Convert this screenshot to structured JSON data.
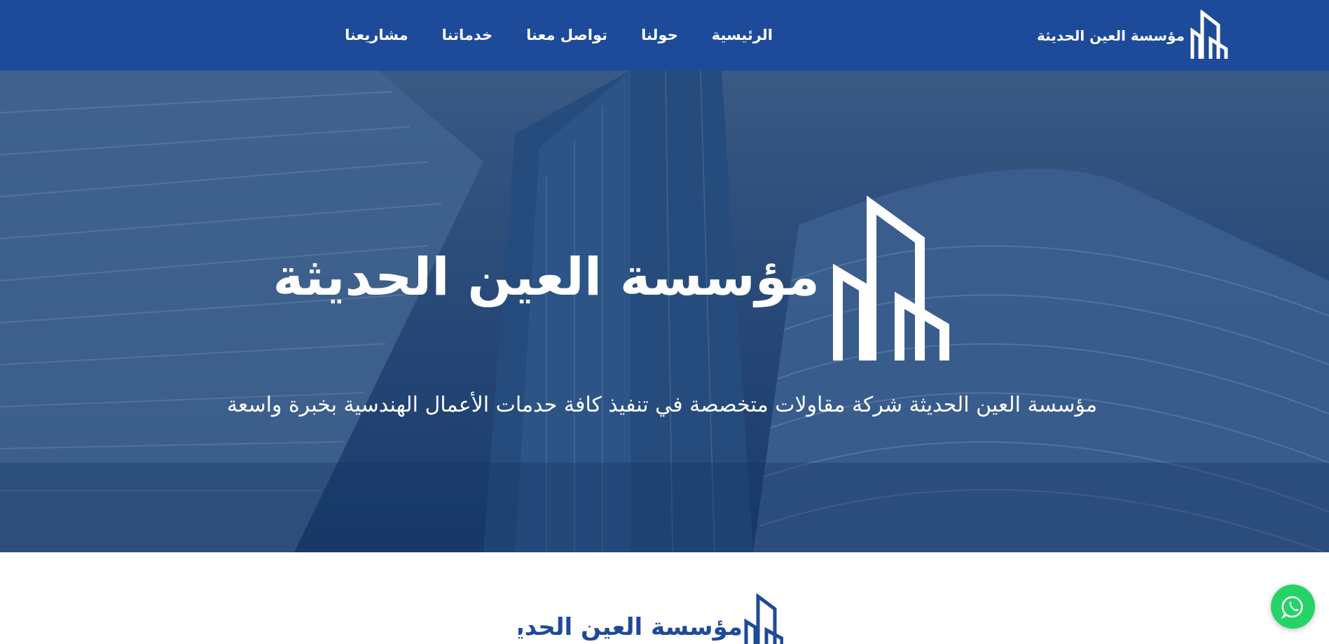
{
  "header": {
    "brand_name": "مؤسسة العين الحديثة",
    "logo_icon": "building-logo-icon",
    "nav": [
      {
        "label": "الرئيسية"
      },
      {
        "label": "حولنا"
      },
      {
        "label": "تواصل معنا"
      },
      {
        "label": "خدماتنا"
      },
      {
        "label": "مشاريعنا"
      }
    ]
  },
  "hero": {
    "title": "مؤسسة العين الحديثة",
    "subtitle": "مؤسسة العين الحديثة شركة مقاولات متخصصة في تنفيذ كافة حدمات الأعمال الهندسية بخبرة واسعة",
    "background": "skyscrapers-photo"
  },
  "section": {
    "brand_name": "مؤسسة العين الحديثة"
  },
  "whatsapp": {
    "icon": "whatsapp-icon"
  },
  "colors": {
    "header_bg": "#1e4a9a",
    "accent": "#1e4a9a",
    "whatsapp": "#25d366",
    "text_light": "#ffffff"
  }
}
